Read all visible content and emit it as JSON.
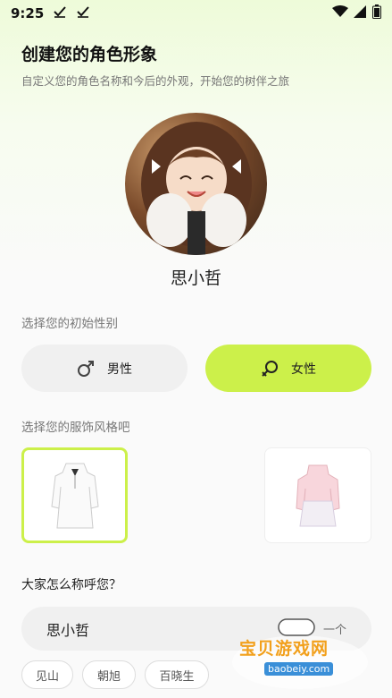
{
  "status": {
    "time": "9:25",
    "icons": [
      "check-icon",
      "check-icon",
      "wifi-icon",
      "signal-icon",
      "battery-icon"
    ]
  },
  "header": {
    "title": "创建您的角色形象",
    "subtitle": "自定义您的角色名称和今后的外观，开始您的树伴之旅"
  },
  "character": {
    "name": "思小哲"
  },
  "gender": {
    "label": "选择您的初始性别",
    "options": [
      {
        "label": "男性",
        "icon": "male-icon",
        "selected": false
      },
      {
        "label": "女性",
        "icon": "female-icon",
        "selected": true
      }
    ]
  },
  "outfit": {
    "label": "选择您的服饰风格吧",
    "options": [
      {
        "name": "white-dress",
        "selected": true
      },
      {
        "name": "pink-dress",
        "selected": false
      }
    ]
  },
  "nickname": {
    "label": "大家怎么称呼您？",
    "value": "思小哲",
    "refresh_label": "一个",
    "suggestions": [
      "见山",
      "朝旭",
      "百晓生"
    ]
  },
  "watermark": {
    "text": "宝贝游戏网",
    "url": "baobeiy.com"
  },
  "colors": {
    "accent": "#ccf04a",
    "neutral_button": "#f0f0f0"
  }
}
